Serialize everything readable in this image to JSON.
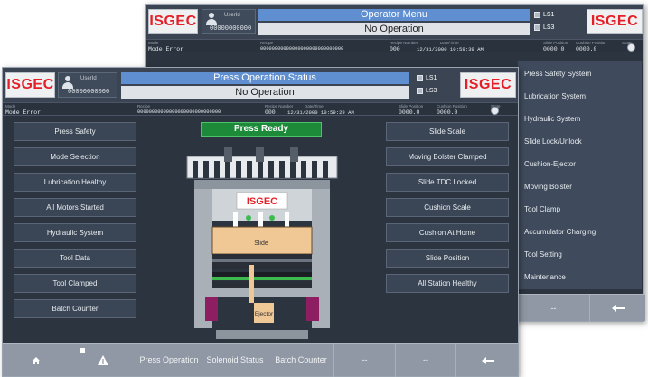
{
  "back_screen": {
    "logo_left": "ISGEC",
    "logo_right": "ISGEC",
    "user_label": "UserId",
    "user_number": "00000000000",
    "title": "Operator Menu",
    "status": "No Operation",
    "ls1": "LS1",
    "ls3": "LS3",
    "mode_caption": "Mode",
    "mode_value": "Mode Error",
    "recipe_caption": "Recipe",
    "recipe_value": "00000000000000000000000000000",
    "recipe_number_caption": "Recipe Number",
    "recipe_number_value": "000",
    "datetime_caption": "Date/Time",
    "datetime_value": "12/31/2000 10:59:39 AM",
    "slide_position_caption": "Slide Position",
    "slide_position_value": "0000.0",
    "cushion_position_caption": "Cushion Position",
    "cushion_position_value": "0000.0",
    "state_caption": "State",
    "menu": [
      "Press Safety System",
      "Lubrication System",
      "Hydraulic System",
      "Slide Lock/Unlock",
      "Cushion-Ejector",
      "Moving Bolster",
      "Tool Clamp",
      "Accumulator Charging",
      "Tool Setting",
      "Maintenance"
    ]
  },
  "front_screen": {
    "logo_left": "ISGEC",
    "logo_right": "ISGEC",
    "user_label": "UserId",
    "user_number": "00000000000",
    "title": "Press Operation Status",
    "status": "No Operation",
    "ls1": "LS1",
    "ls3": "LS3",
    "mode_caption": "Mode",
    "mode_value": "Mode Error",
    "recipe_caption": "Recipe",
    "recipe_value": "00000000000000000000000000000",
    "recipe_number_caption": "Recipe Number",
    "recipe_number_value": "000",
    "datetime_caption": "Date/Time",
    "datetime_value": "12/31/2000 10:59:29 AM",
    "slide_position_caption": "Slide Position",
    "slide_position_value": "0000.0",
    "cushion_position_caption": "Cushion Position",
    "cushion_position_value": "0000.0",
    "state_caption": "State",
    "left_buttons": [
      "Press Safety",
      "Mode Selection",
      "Lubrication Healthy",
      "All Motors Started",
      "Hydraulic System",
      "Tool Data",
      "Tool Clamped",
      "Batch Counter"
    ],
    "right_buttons": [
      "Slide Scale",
      "Moving Bolster Clamped",
      "Slide TDC Locked",
      "Cushion Scale",
      "Cushion At Home",
      "Slide Position",
      "All Station Healthy"
    ],
    "ready_label": "Press Ready",
    "press_logo": "ISGEC",
    "slide_label": "Slide",
    "ejector_label": "Ejector",
    "toolbar": {
      "press_operation": "Press Operation",
      "solenoid_status": "Solenoid Status",
      "batch_counter": "Batch Counter",
      "empty1": "--",
      "empty2": "--"
    }
  },
  "colors": {
    "title_blue": "#5f8fd0",
    "ready_green": "#1d8a3a",
    "logo_red": "#e51f27",
    "slide_tan": "#f0c896",
    "ejector_magenta": "#8e1e62"
  },
  "icons": [
    "home-icon",
    "warning-icon",
    "back-arrow-icon",
    "user-icon"
  ]
}
